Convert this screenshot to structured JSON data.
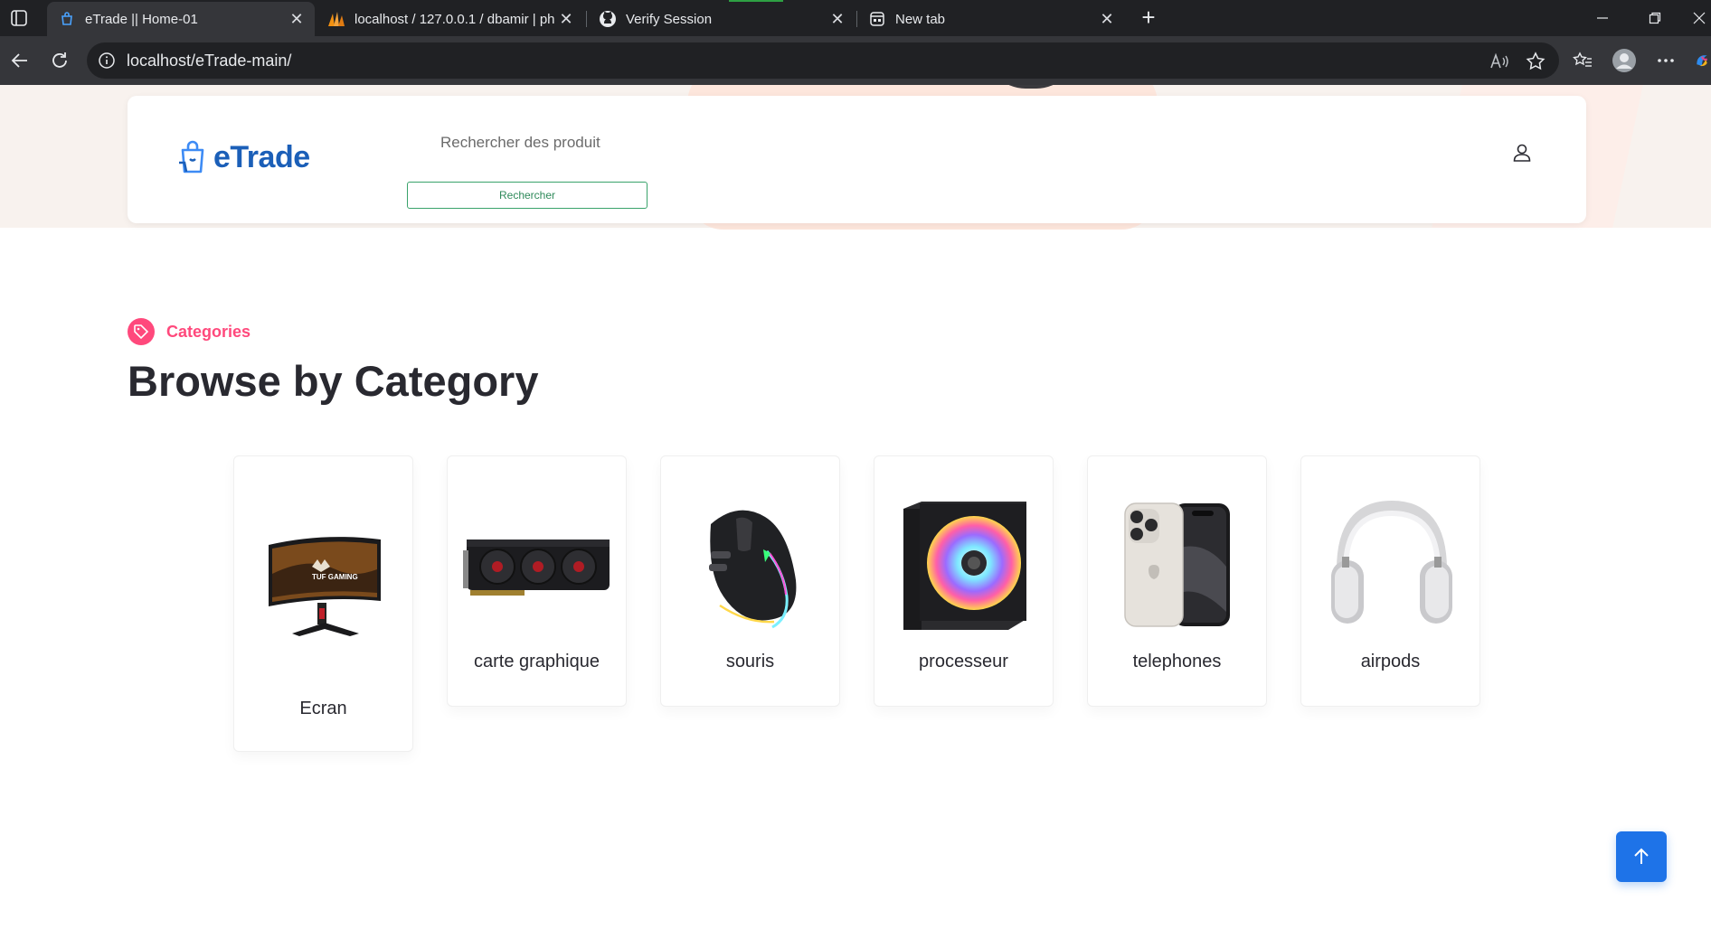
{
  "browser": {
    "tabs": [
      {
        "title": "eTrade || Home-01",
        "icon": "etrade-favicon",
        "active": true
      },
      {
        "title": "localhost / 127.0.0.1 / dbamir | ph",
        "icon": "phpmyadmin-icon",
        "active": false
      },
      {
        "title": "Verify Session",
        "icon": "github-icon",
        "active": false
      },
      {
        "title": "New tab",
        "icon": "newtab-icon",
        "active": false
      }
    ],
    "url": "localhost/eTrade-main/"
  },
  "header": {
    "logo_text": "eTrade",
    "search_placeholder": "Rechercher des produit",
    "search_button": "Rechercher"
  },
  "categories": {
    "tag": "Categories",
    "title": "Browse by Category",
    "items": [
      {
        "name": "Ecran",
        "image": "monitor-image"
      },
      {
        "name": "carte graphique",
        "image": "graphics-card-image"
      },
      {
        "name": "souris",
        "image": "gaming-mouse-image"
      },
      {
        "name": "processeur",
        "image": "cpu-cooler-image"
      },
      {
        "name": "telephones",
        "image": "smartphone-image"
      },
      {
        "name": "airpods",
        "image": "headphones-image"
      }
    ]
  },
  "colors": {
    "accent_pink": "#ff497c",
    "brand_blue": "#1b5fb8",
    "button_green": "#3aa36b",
    "scroll_blue": "#1e73e8"
  }
}
